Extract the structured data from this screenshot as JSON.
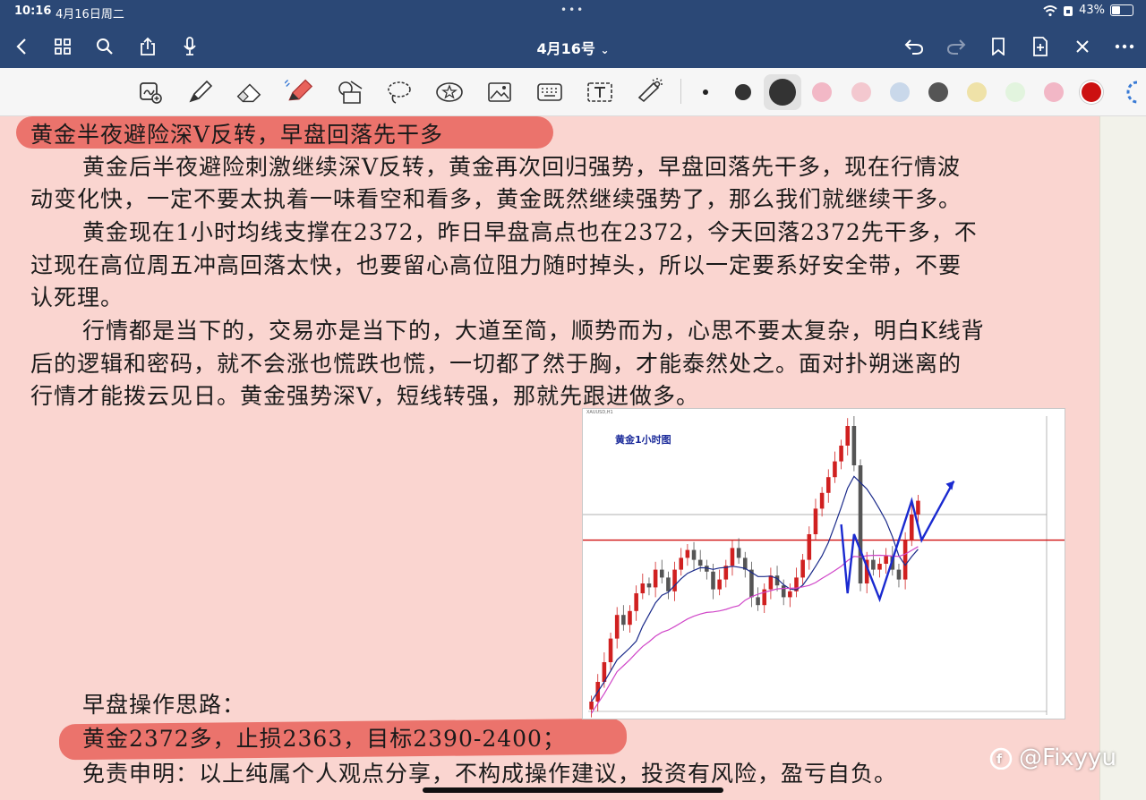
{
  "status_bar": {
    "time": "10:16",
    "date": "4月16日周二",
    "battery": "43%",
    "battery_level": 0.43
  },
  "nav": {
    "title": "4月16号",
    "title_chevron": "⌄"
  },
  "icons": {
    "back": "chevron-left-icon",
    "grid": "grid-icon",
    "search": "search-icon",
    "share": "share-icon",
    "mic": "mic-icon",
    "undo": "undo-icon",
    "redo": "redo-icon",
    "bookmark": "bookmark-icon",
    "add_page": "add-page-icon",
    "close": "close-icon",
    "more": "more-icon"
  },
  "tools": [
    "lasso-select-icon",
    "pen-icon",
    "eraser-icon",
    "highlighter-icon",
    "shapes-icon",
    "lasso-icon",
    "sticker-icon",
    "image-icon",
    "keyboard-icon",
    "text-icon",
    "laser-pointer-icon"
  ],
  "colors": {
    "accent": "#2b4876",
    "page": "#fad5d0",
    "highlight": "#e8625b",
    "swatches": [
      "#222222",
      "#333333",
      "#333333",
      "#f2b8c6",
      "#f3c8cf",
      "#c9d8ea",
      "#555555",
      "#efe2a8",
      "#e2f4de",
      "#f2b7c6",
      "#cc1111"
    ]
  },
  "note": {
    "lines": [
      "黄金半夜避险深V反转，早盘回落先干多",
      "黄金后半夜避险刺激继续深V反转，黄金再次回归强势，早盘回落先干多，现在行情波",
      "动变化快，一定不要太执着一味看空和看多，黄金既然继续强势了，那么我们就继续干多。",
      "黄金现在1小时均线支撑在2372，昨日早盘高点也在2372，今天回落2372先干多，不",
      "过现在高位周五冲高回落太快，也要留心高位阻力随时掉头，所以一定要系好安全带，不要",
      "认死理。",
      "行情都是当下的，交易亦是当下的，大道至简，顺势而为，心思不要太复杂，明白K线背",
      "后的逻辑和密码，就不会涨也慌跌也慌，一切都了然于胸，才能泰然处之。面对扑朔迷离的",
      "行情才能拨云见日。黄金强势深V，短线转强，那就先跟进做多。",
      "早盘操作思路：",
      "黄金2372多，止损2363，目标2390-2400；",
      "免责申明：以上纯属个人观点分享，不构成操作建议，投资有风险，盈亏自负。"
    ]
  },
  "chart": {
    "title": "黄金1小时图",
    "header": "XAUUSD,H1"
  },
  "chart_data": {
    "type": "candlestick",
    "title": "黄金1小时图",
    "symbol": "XAUUSD,H1",
    "price_range": [
      2285,
      2435
    ],
    "closes": [
      2290,
      2300,
      2310,
      2322,
      2334,
      2329,
      2336,
      2345,
      2350,
      2348,
      2357,
      2353,
      2346,
      2357,
      2363,
      2367,
      2362,
      2359,
      2356,
      2347,
      2352,
      2359,
      2368,
      2363,
      2357,
      2343,
      2339,
      2347,
      2354,
      2349,
      2343,
      2346,
      2353,
      2362,
      2375,
      2388,
      2396,
      2404,
      2412,
      2420,
      2430,
      2410,
      2350,
      2362,
      2357,
      2360,
      2364,
      2357,
      2352,
      2372,
      2385,
      2392
    ],
    "horizontal_lines": [
      2372,
      2385
    ],
    "forecast": [
      2372,
      2402
    ],
    "series": [
      {
        "name": "blue MA",
        "color": "#1a2a8a"
      },
      {
        "name": "magenta MA",
        "color": "#d046c8"
      }
    ]
  },
  "watermark": "@Fixyyu"
}
